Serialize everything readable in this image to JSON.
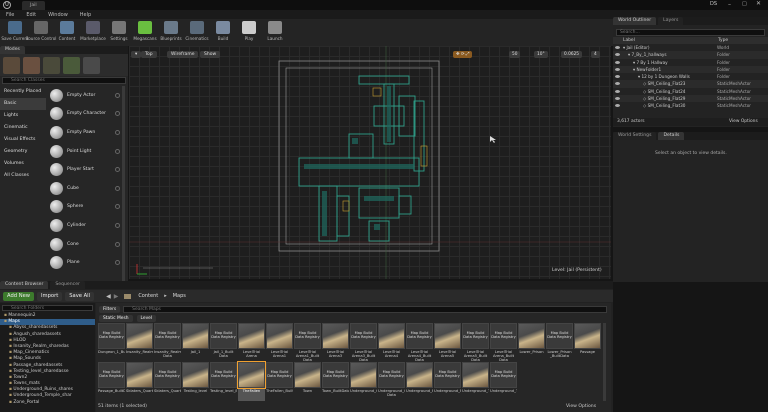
{
  "titlebar": {
    "tab": "Jail",
    "user": "DS"
  },
  "menu": [
    "File",
    "Edit",
    "Window",
    "Help"
  ],
  "toolbar": [
    {
      "label": "Save Current",
      "color": "#4a6b8c"
    },
    {
      "label": "Source Control",
      "color": "#666666"
    },
    {
      "label": "Content",
      "color": "#5b7b9b"
    },
    {
      "label": "Marketplace",
      "color": "#5a5a6a"
    },
    {
      "label": "Settings",
      "color": "#777777"
    },
    {
      "label": "Megascans",
      "color": "#6abf40"
    },
    {
      "label": "Blueprints",
      "color": "#6a7a8a"
    },
    {
      "label": "Cinematics",
      "color": "#5a6a7a"
    },
    {
      "label": "Build",
      "color": "#7a8aa0"
    },
    {
      "label": "Play",
      "color": "#cccccc"
    },
    {
      "label": "Launch",
      "color": "#8a8a8a"
    }
  ],
  "modes": {
    "tab": "Modes",
    "search_placeholder": "Search Classes",
    "categories": [
      "Recently Placed",
      "Basic",
      "Lights",
      "Cinematic",
      "Visual Effects",
      "Geometry",
      "Volumes",
      "All Classes"
    ],
    "selected_category": "Basic",
    "items": [
      "Empty Actor",
      "Empty Character",
      "Empty Pawn",
      "Point Light",
      "Player Start",
      "Cube",
      "Sphere",
      "Cylinder",
      "Cone",
      "Plane"
    ]
  },
  "viewport": {
    "perspective": "Top",
    "view_mode": "Wireframe",
    "show": "Show",
    "grid": "50",
    "rotation": "10°",
    "scale": "0.0625",
    "camera_speed": "4",
    "level_label": "Level:  Jail (Persistent)"
  },
  "outliner": {
    "tabs": [
      "World Outliner",
      "Layers"
    ],
    "search_placeholder": "Search...",
    "columns": [
      "Label",
      "Type"
    ],
    "rows": [
      {
        "label": "Jail (Editor)",
        "type": "World",
        "indent": 0
      },
      {
        "label": "7_By_1_hallways",
        "type": "Folder",
        "indent": 1
      },
      {
        "label": "7 By 1 Hallway",
        "type": "Folder",
        "indent": 2
      },
      {
        "label": "NewFolder1",
        "type": "Folder",
        "indent": 2
      },
      {
        "label": "12 by 1 Dungeon Walls",
        "type": "Folder",
        "indent": 3
      },
      {
        "label": "SM_Ceiling_Flat23",
        "type": "StaticMeshActor",
        "indent": 4
      },
      {
        "label": "SM_Ceiling_Flat24",
        "type": "StaticMeshActor",
        "indent": 4
      },
      {
        "label": "SM_Ceiling_Flat29",
        "type": "StaticMeshActor",
        "indent": 4
      },
      {
        "label": "SM_Ceiling_Flat30",
        "type": "StaticMeshActor",
        "indent": 4
      }
    ],
    "count": "3,617 actors",
    "view_options": "View Options"
  },
  "details": {
    "tabs": [
      "World Settings",
      "Details"
    ],
    "empty_text": "Select an object to view details."
  },
  "content_browser": {
    "tabs": [
      "Content Browser",
      "Sequencer"
    ],
    "add_new": "Add New",
    "import": "Import",
    "save_all": "Save All",
    "path": [
      "Content",
      "Maps"
    ],
    "search_folders": "Search Folders",
    "filters": "Filters",
    "search_assets": "Search Maps",
    "filter_chips": [
      "Static Mesh",
      "Level"
    ],
    "folders": [
      {
        "label": "Mannequin2",
        "sel": false
      },
      {
        "label": "Maps",
        "sel": true
      },
      {
        "label": "Abyss_sharedassets",
        "sel": false
      },
      {
        "label": "Angush_sharedassets",
        "sel": false
      },
      {
        "label": "HLOD",
        "sel": false
      },
      {
        "label": "Insanity_Realm_sharedas",
        "sel": false
      },
      {
        "label": "Map_Cinematics",
        "sel": false
      },
      {
        "label": "Map_Sounds",
        "sel": false
      },
      {
        "label": "Passage_sharedassets",
        "sel": false
      },
      {
        "label": "Testing_level_sharedasse",
        "sel": false
      },
      {
        "label": "Town2",
        "sel": false
      },
      {
        "label": "Towns_mats",
        "sel": false
      },
      {
        "label": "Underground_Ruins_shares",
        "sel": false
      },
      {
        "label": "Underground_Temple_shar",
        "sel": false
      },
      {
        "label": "Zone_Portal",
        "sel": false
      }
    ],
    "row1": [
      {
        "label": "Dungeon_1_BuiltData",
        "thumb": "map",
        "tlabel": "Map Build Data Registry"
      },
      {
        "label": "Insanity_Realm",
        "thumb": "prev"
      },
      {
        "label": "Insanity_Realm_Built Data",
        "thumb": "map",
        "tlabel": "Map Build Data Registry"
      },
      {
        "label": "Jail_1",
        "thumb": "prev"
      },
      {
        "label": "Jail_1_Built Data",
        "thumb": "map",
        "tlabel": "Map Build Data Registry"
      },
      {
        "label": "LevelTrial Arena",
        "thumb": "prev"
      },
      {
        "label": "LevelTrial Arena1",
        "thumb": "prev"
      },
      {
        "label": "LevelTrial Arena1_Built Data",
        "thumb": "map",
        "tlabel": "Map Build Data Registry"
      },
      {
        "label": "LevelTrial Arena3",
        "thumb": "prev"
      },
      {
        "label": "LevelTrial Arena3_Built Data",
        "thumb": "map",
        "tlabel": "Map Build Data Registry"
      },
      {
        "label": "LevelTrial Arena4",
        "thumb": "prev"
      },
      {
        "label": "LevelTrial Arena4_Built Data",
        "thumb": "map",
        "tlabel": "Map Build Data Registry"
      },
      {
        "label": "LevelTrial Arena5",
        "thumb": "prev"
      },
      {
        "label": "LevelTrial Arena5_Built Data",
        "thumb": "map",
        "tlabel": "Map Build Data Registry"
      },
      {
        "label": "LevelTrial Arena_Built Data",
        "thumb": "map",
        "tlabel": "Map Build Data Registry"
      },
      {
        "label": "Lower_Prison",
        "thumb": "prev"
      },
      {
        "label": "Lower_Prison _BuiltData",
        "thumb": "map",
        "tlabel": "Map Build Data Registry"
      },
      {
        "label": "Passage",
        "thumb": "prev"
      }
    ],
    "row2": [
      {
        "label": "Passage_BuiltData",
        "thumb": "map",
        "tlabel": "Map Build Data Registry"
      },
      {
        "label": "Sklaters_Quarters",
        "thumb": "prev"
      },
      {
        "label": "Sklaters_Quarters_BuiltData",
        "thumb": "map",
        "tlabel": "Map Build Data Registry"
      },
      {
        "label": "Testing_level",
        "thumb": "prev"
      },
      {
        "label": "Testing_level_BuiltData",
        "thumb": "map",
        "tlabel": "Map Build Data Registry"
      },
      {
        "label": "TheFallen",
        "thumb": "prev",
        "sel": true
      },
      {
        "label": "TheFallen_BuiltData",
        "thumb": "map",
        "tlabel": "Map Build Data Registry"
      },
      {
        "label": "Town",
        "thumb": "prev"
      },
      {
        "label": "Town_BuiltData",
        "thumb": "map",
        "tlabel": "Map Build Data Registry"
      },
      {
        "label": "Underground_Crypt",
        "thumb": "prev"
      },
      {
        "label": "Underground_Crypt_Built Data",
        "thumb": "map",
        "tlabel": "Map Build Data Registry"
      },
      {
        "label": "Underground_Ruins",
        "thumb": "prev"
      },
      {
        "label": "Underground_Ruins_BuiltData",
        "thumb": "map",
        "tlabel": "Map Build Data Registry"
      },
      {
        "label": "Underground_Temple",
        "thumb": "prev"
      },
      {
        "label": "Underground_Temple_BuiltData",
        "thumb": "map",
        "tlabel": "Map Build Data Registry"
      }
    ],
    "status": "51 items (1 selected)",
    "view_options": "View Options"
  }
}
